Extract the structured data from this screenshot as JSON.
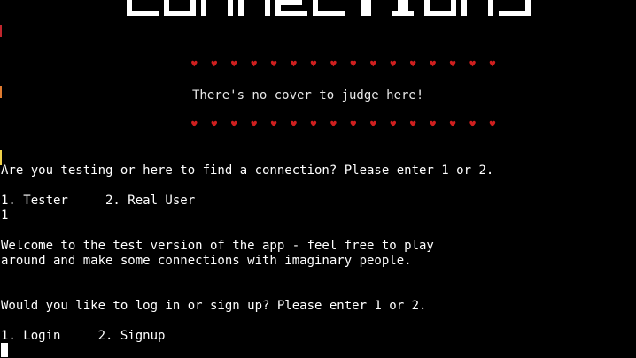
{
  "banner": {
    "title": "CONNECTIONS",
    "color": "#ffffff"
  },
  "hearts": {
    "top": "♥ ♥ ♥ ♥ ♥ ♥ ♥ ♥ ♥ ♥ ♥ ♥ ♥ ♥ ♥ ♥",
    "bottom": "♥ ♥ ♥ ♥ ♥ ♥ ♥ ♥ ♥ ♥ ♥ ♥ ♥ ♥ ♥ ♥",
    "color": "#d01f1f"
  },
  "tagline": "There's no cover to judge here!",
  "prompt1": {
    "question": "Are you testing or here to find a connection? Please enter 1 or 2.",
    "options": "1. Tester     2. Real User",
    "answer": "1"
  },
  "welcome": {
    "line1": "Welcome to the test version of the app - feel free to play",
    "line2": "around and make some connections with imaginary people."
  },
  "prompt2": {
    "question": "Would you like to log in or sign up? Please enter 1 or 2.",
    "options": "1. Login     2. Signup"
  },
  "colors": {
    "background": "#000000",
    "text": "#ffffff",
    "heart": "#d01f1f",
    "edge_red": "#c0262d",
    "edge_orange": "#e07b30",
    "edge_yellow": "#f0d24a"
  }
}
